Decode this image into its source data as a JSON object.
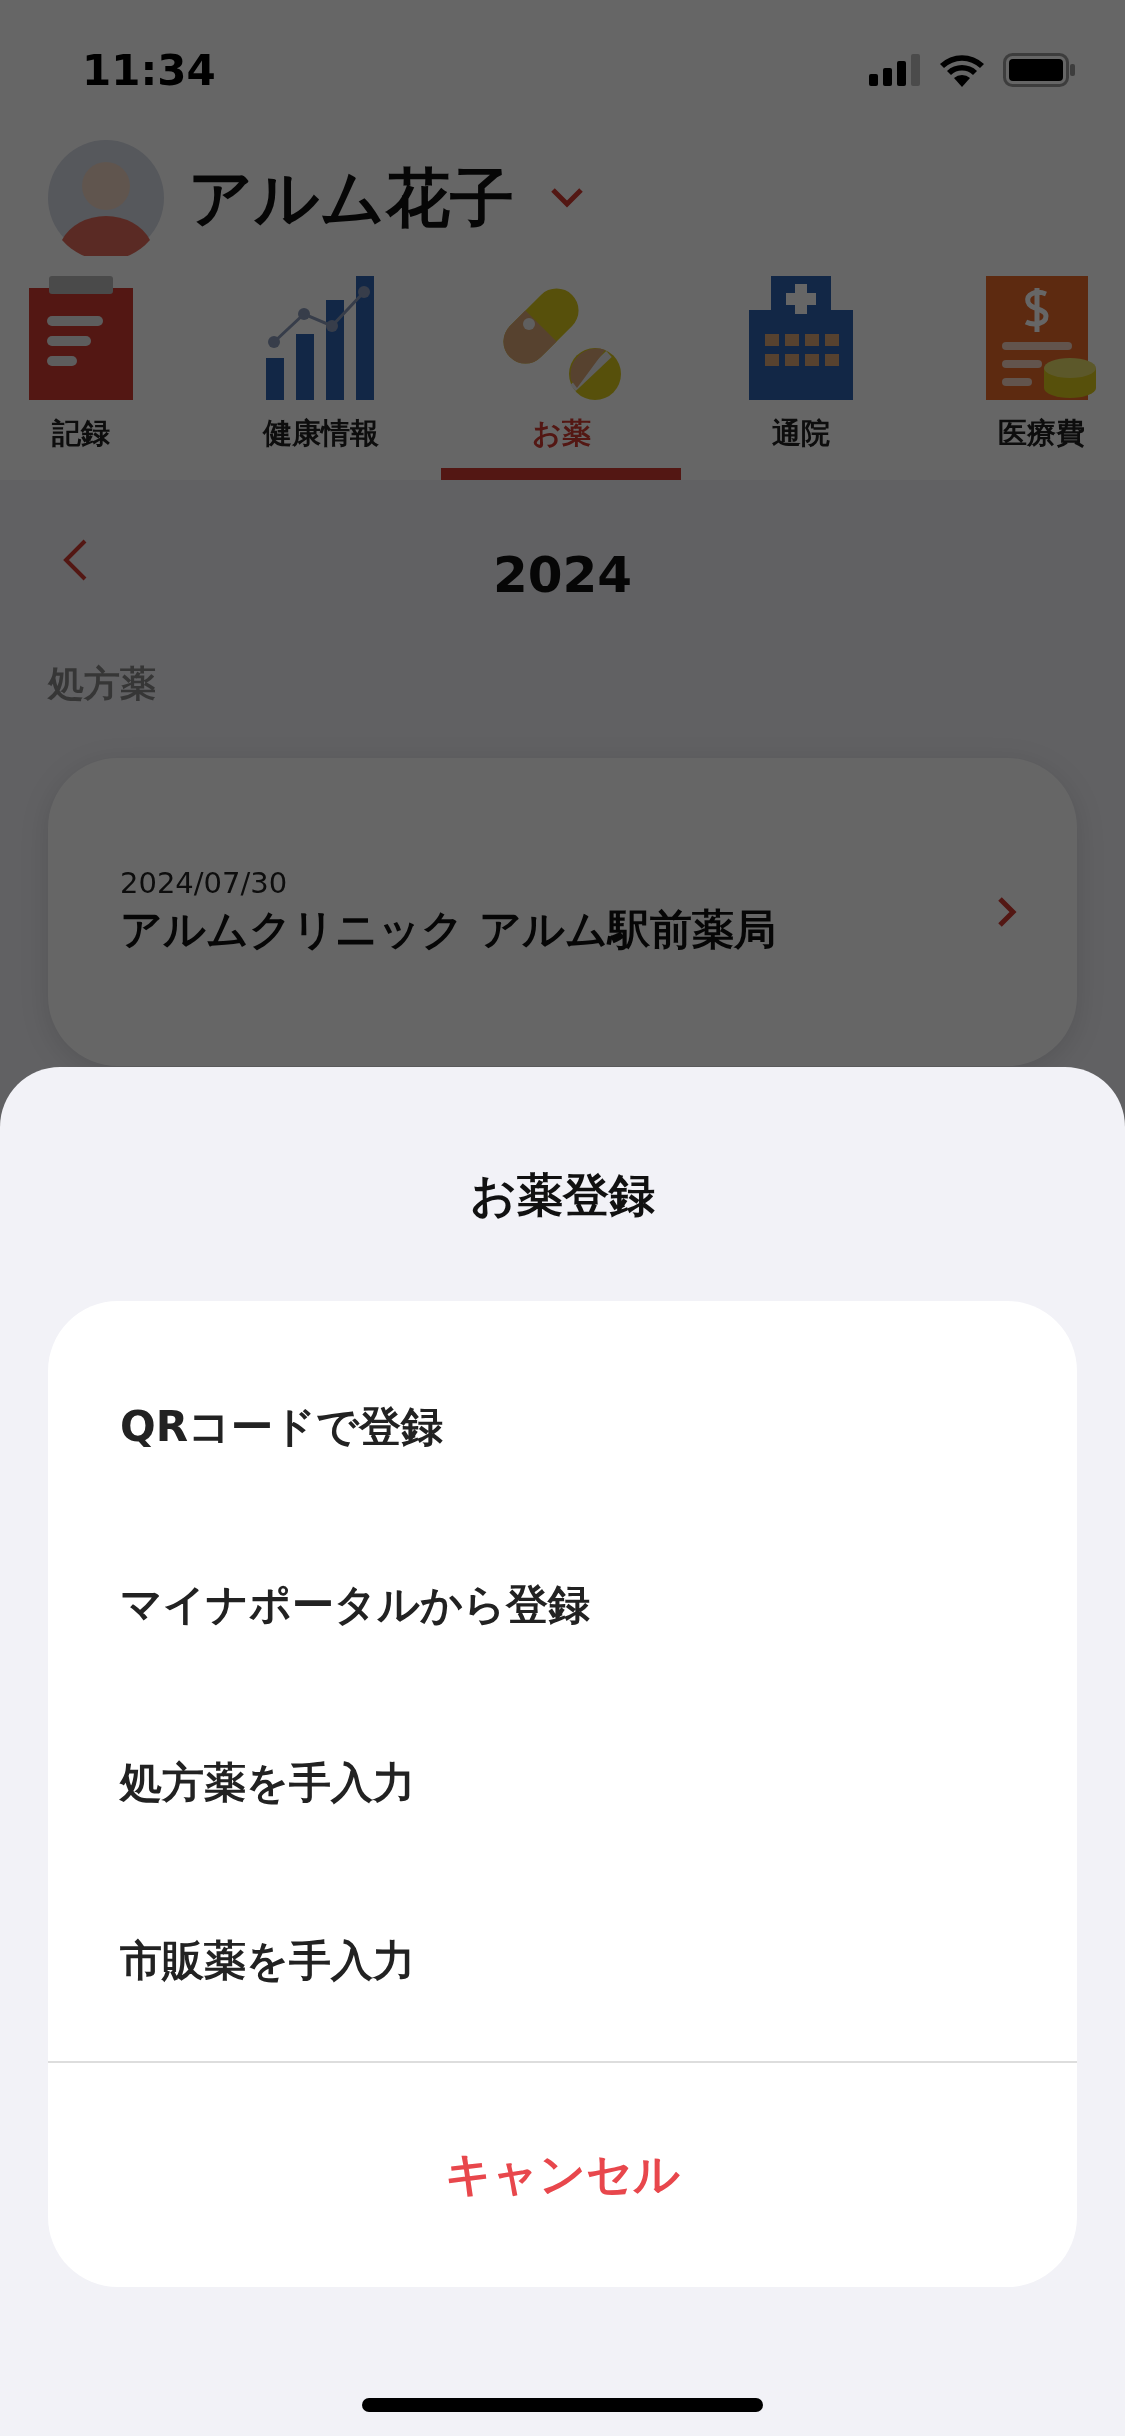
{
  "status_bar": {
    "time": "11:34"
  },
  "profile": {
    "name": "アルム花子"
  },
  "tabs": [
    {
      "label": "記録",
      "kind": "clipboard",
      "selected": false
    },
    {
      "label": "健康情報",
      "kind": "chart",
      "selected": false
    },
    {
      "label": "お薬",
      "kind": "pills",
      "selected": true
    },
    {
      "label": "通院",
      "kind": "hospital",
      "selected": false
    },
    {
      "label": "医療費",
      "kind": "bill",
      "selected": false
    }
  ],
  "year_nav": {
    "year": "2024"
  },
  "section_title": "処方薬",
  "prescriptions": [
    {
      "date": "2024/07/30",
      "pharmacy": "アルムクリニック アルム駅前薬局"
    }
  ],
  "sheet": {
    "title": "お薬登録",
    "options": [
      "QRコードで登録",
      "マイナポータルから登録",
      "処方薬を手入力",
      "市販薬を手入力"
    ],
    "cancel": "キャンセル"
  }
}
